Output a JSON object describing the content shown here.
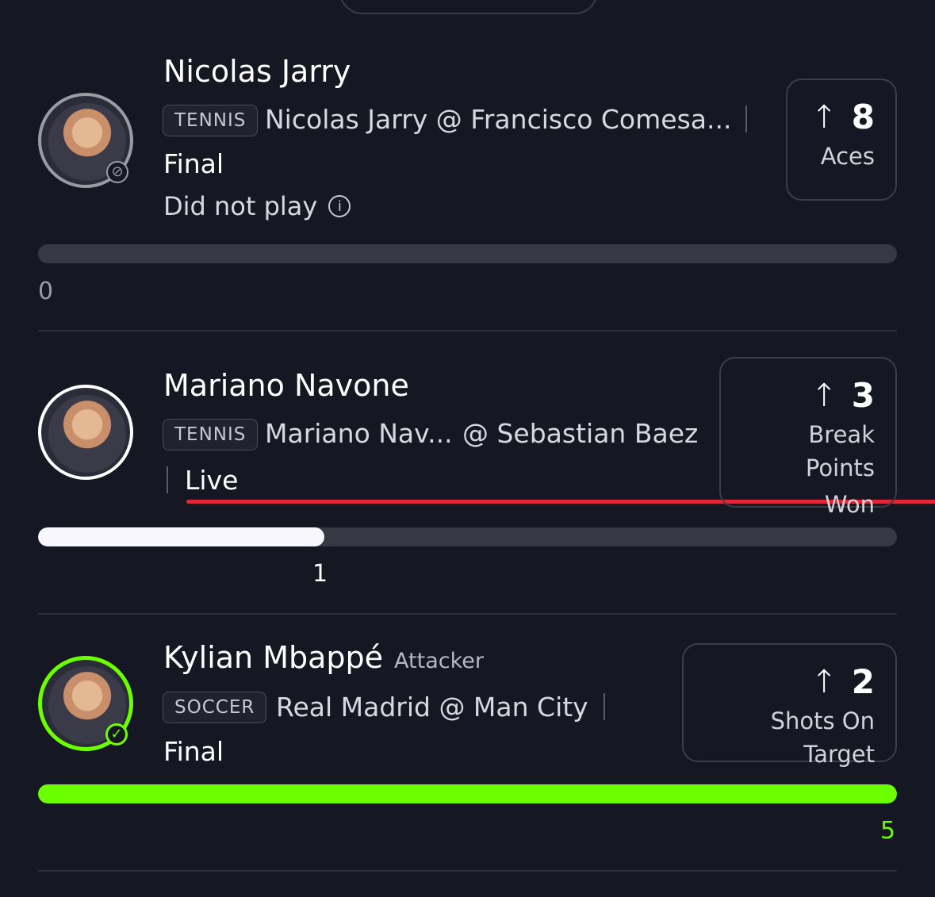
{
  "colors": {
    "background": "#151822",
    "track": "#363944",
    "white_fill": "#f8f6ff",
    "green": "#6cff00",
    "live_red": "#e0263b"
  },
  "cards": [
    {
      "name": "Nicolas Jarry",
      "role": "",
      "sport": "TENNIS",
      "matchup": "Nicolas Jarry @ Francisco Comesa...",
      "status": "Final",
      "note": "Did not play",
      "stat": {
        "arrow": "↑",
        "value": "8",
        "label": "Aces"
      },
      "progress": {
        "value": "0",
        "fraction": 0.0,
        "color": "#363944"
      },
      "badge_icon": "no-entry-icon"
    },
    {
      "name": "Mariano Navone",
      "role": "",
      "sport": "TENNIS",
      "matchup": "Mariano Nav...",
      "matchup_b": "@ Sebastian Baez",
      "status": "Live",
      "stat": {
        "arrow": "↑",
        "value": "3",
        "label_line1": "Break Points",
        "label_line2": "Won"
      },
      "progress": {
        "value": "1",
        "fraction": 0.333,
        "color": "#f8f6ff"
      }
    },
    {
      "name": "Kylian Mbappé",
      "role": "Attacker",
      "sport": "SOCCER",
      "matchup": "Real Madrid @ Man City",
      "status": "Final",
      "stat": {
        "arrow": "↑",
        "value": "2",
        "label": "Shots On Target"
      },
      "progress": {
        "value": "5",
        "fraction": 1.0,
        "color": "#6cff00"
      },
      "badge_icon": "check-icon"
    }
  ]
}
